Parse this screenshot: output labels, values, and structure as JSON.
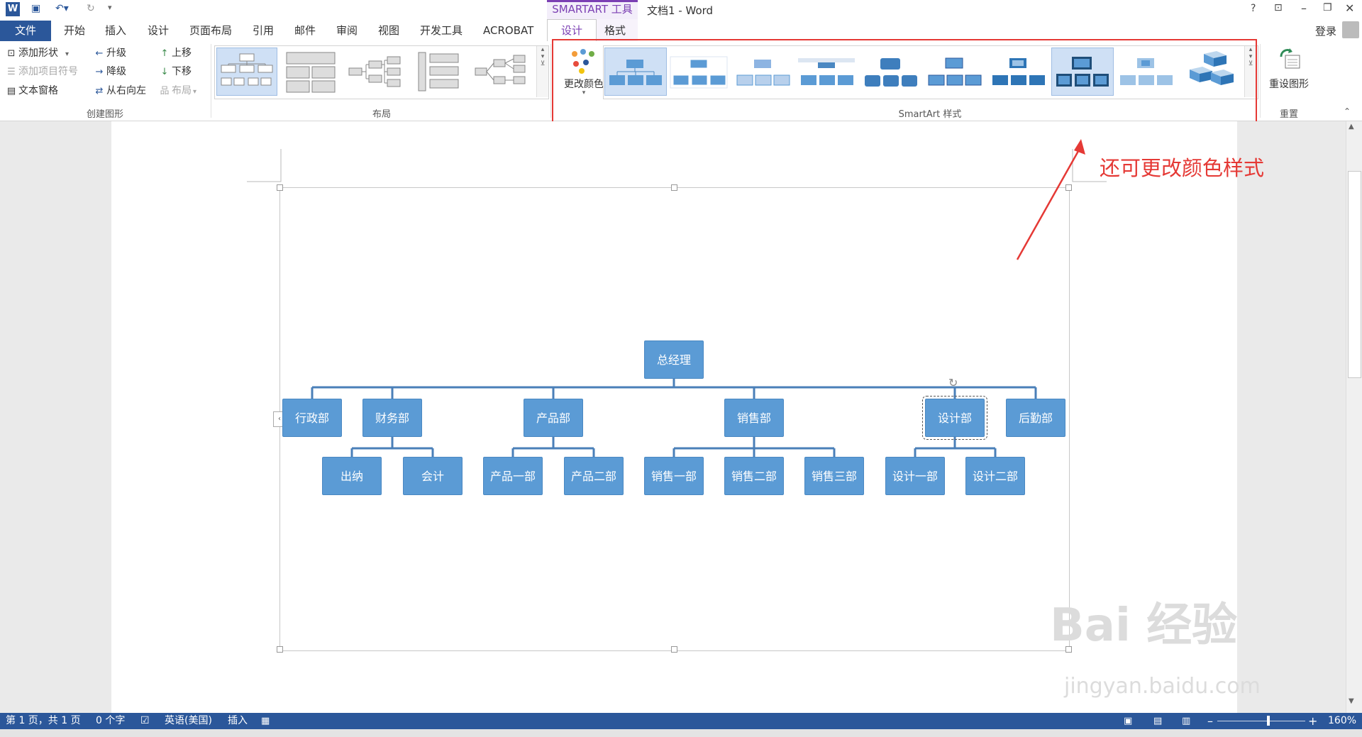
{
  "titlebar": {
    "app_icon": "word-icon",
    "save_icon": "save-icon",
    "undo_icon": "undo-icon",
    "redo_icon": "redo-icon",
    "context_title": "SMARTART 工具",
    "title": "文档1 - Word",
    "help": "?",
    "controls": [
      "restore-ribbon-icon",
      "minimize-icon",
      "restore-icon",
      "close-icon"
    ],
    "login": "登录"
  },
  "tabs": [
    "开始",
    "插入",
    "设计",
    "页面布局",
    "引用",
    "邮件",
    "审阅",
    "视图",
    "开发工具",
    "ACROBAT"
  ],
  "file_tab": "文件",
  "context_tabs": [
    "设计",
    "格式"
  ],
  "create_group": {
    "label": "创建图形",
    "add_shape": "添加形状",
    "add_bullet": "添加项目符号",
    "text_pane": "文本窗格",
    "promote": "升级",
    "demote": "降级",
    "rtl": "从右向左",
    "move_up": "上移",
    "move_down": "下移",
    "layout": "布局"
  },
  "layout_group": {
    "label": "布局"
  },
  "styles_group": {
    "label": "SmartArt 样式",
    "change_colors": "更改颜色"
  },
  "reset_group": {
    "label": "重置",
    "reset_graphic": "重设图形"
  },
  "org_chart": {
    "top": "总经理",
    "departments": [
      "行政部",
      "财务部",
      "产品部",
      "销售部",
      "设计部",
      "后勤部"
    ],
    "sub_finance": [
      "出纳",
      "会计"
    ],
    "sub_product": [
      "产品一部",
      "产品二部"
    ],
    "sub_sales": [
      "销售一部",
      "销售二部",
      "销售三部"
    ],
    "sub_design": [
      "设计一部",
      "设计二部"
    ]
  },
  "annotation": "还可更改颜色样式",
  "watermark": {
    "main": "Bai 经验",
    "url": "jingyan.baidu.com"
  },
  "statusbar": {
    "page": "第 1 页，共 1 页",
    "words": "0 个字",
    "lang": "英语(美国)",
    "mode": "插入",
    "zoom": "160%"
  },
  "colors": {
    "accent": "#2b579a",
    "node": "#5b9bd5",
    "annot": "#e53935",
    "context": "#7b3fb3"
  }
}
